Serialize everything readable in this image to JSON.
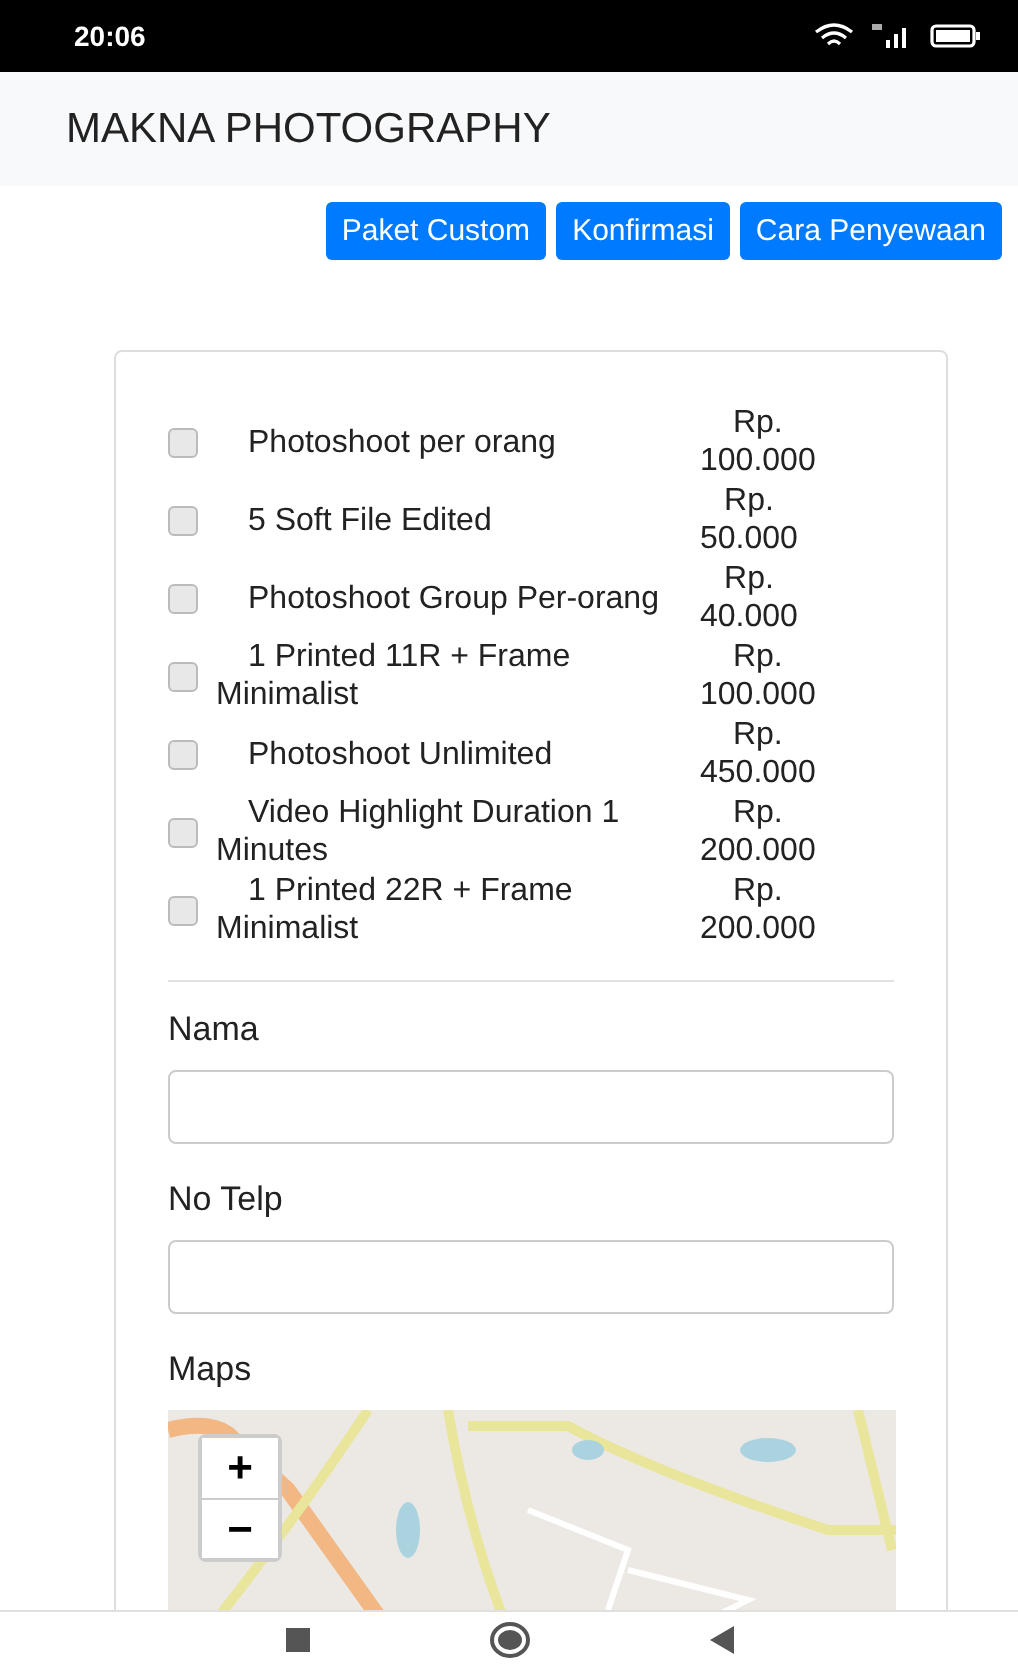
{
  "status_bar": {
    "time": "20:06"
  },
  "app_bar": {
    "title": "MAKNA PHOTOGRAPHY"
  },
  "nav_buttons": [
    "Paket Custom",
    "Konfirmasi",
    "Cara Penyewaan"
  ],
  "packages": [
    {
      "label": "Photoshoot per orang",
      "price_prefix": "Rp.",
      "price": "100.000",
      "checked": false
    },
    {
      "label": "5 Soft File Edited",
      "price_prefix": "Rp.",
      "price": "50.000",
      "checked": false
    },
    {
      "label": "Photoshoot Group Per-orang",
      "price_prefix": "Rp.",
      "price": "40.000",
      "checked": false
    },
    {
      "label": "1 Printed 11R + Frame Minimalist",
      "price_prefix": "Rp.",
      "price": "100.000",
      "checked": false
    },
    {
      "label": "Photoshoot Unlimited",
      "price_prefix": "Rp.",
      "price": "450.000",
      "checked": false
    },
    {
      "label": "Video Highlight Duration 1 Minutes",
      "price_prefix": "Rp.",
      "price": "200.000",
      "checked": false
    },
    {
      "label": "1 Printed 22R + Frame Minimalist",
      "price_prefix": "Rp.",
      "price": "200.000",
      "checked": false
    }
  ],
  "fields": [
    {
      "label": "Nama"
    },
    {
      "label": "No Telp"
    }
  ],
  "map": {
    "label": "Maps",
    "zoom_in": "+",
    "zoom_out": "−",
    "kind": "picture"
  }
}
